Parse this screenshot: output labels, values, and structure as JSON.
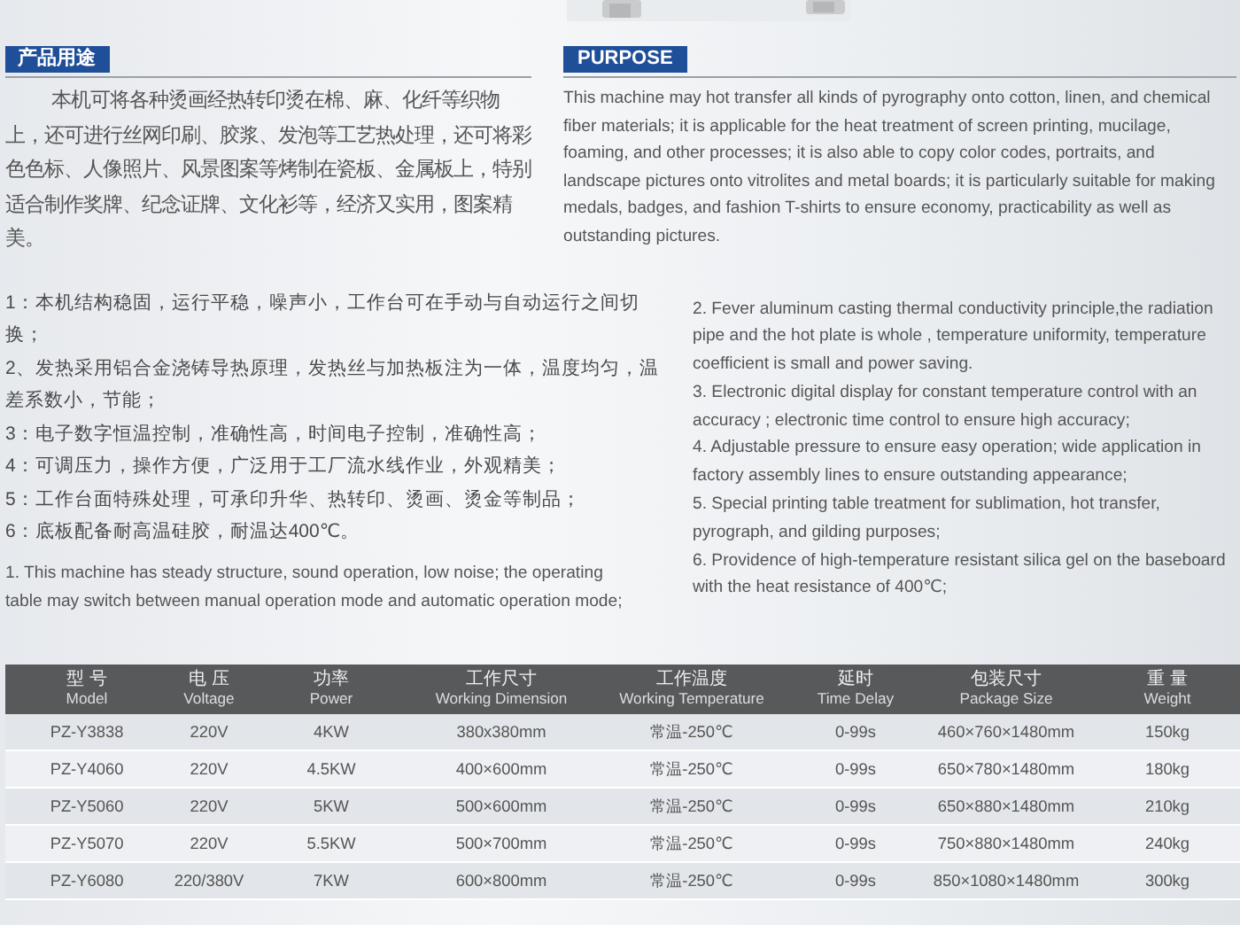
{
  "photo": {
    "kind": "picture"
  },
  "purpose_cn": {
    "heading": "产品用途",
    "text": "本机可将各种烫画经热转印烫在棉、麻、化纤等织物上，还可进行丝网印刷、胶浆、发泡等工艺热处理，还可将彩色色标、人像照片、风景图案等烤制在瓷板、金属板上，特别适合制作奖牌、纪念证牌、文化衫等，经济又实用，图案精美。"
  },
  "purpose_en": {
    "heading": "PURPOSE",
    "text": "This machine may hot transfer all kinds of pyrography onto cotton, linen, and chemical fiber materials; it is applicable for the heat treatment of screen printing, mucilage, foaming, and other processes; it is also able to copy color codes, portraits, and landscape pictures onto vitrolites and metal boards; it is particularly suitable for making medals, badges, and fashion T-shirts to ensure economy, practicability as well as outstanding pictures."
  },
  "features_cn": [
    "1：本机结构稳固，运行平稳，噪声小，工作台可在手动与自动运行之间切换；",
    "2、发热采用铝合金浇铸导热原理，发热丝与加热板注为一体，温度均匀，温差系数小，节能；",
    "3：电子数字恒温控制，准确性高，时间电子控制，准确性高；",
    "4：可调压力，操作方便，广泛用于工厂流水线作业，外观精美；",
    "5：工作台面特殊处理，可承印升华、热转印、烫画、烫金等制品；",
    "6：底板配备耐高温硅胶，耐温达400℃。"
  ],
  "features_en_left": [
    "1. This machine has steady structure, sound operation, low noise; the operating table may switch between manual operation mode and automatic operation mode;"
  ],
  "features_en_right": [
    "2. Fever  aluminum casting thermal conductivity principle,the radiation pipe and the hot plate is whole , temperature uniformity, temperature coefficient is small and power saving.",
    "3. Electronic digital display for constant temperature control with an accuracy ; electronic time control to ensure high accuracy;",
    "4. Adjustable pressure to ensure easy operation; wide application in factory assembly lines to ensure outstanding appearance;",
    "5. Special printing table treatment for sublimation, hot transfer, pyrograph, and gilding purposes;",
    "6. Providence of high-temperature resistant silica gel on the baseboard with the heat resistance of 400℃;"
  ],
  "table": {
    "columns": [
      {
        "cn": "型 号",
        "en": "Model"
      },
      {
        "cn": "电 压",
        "en": "Voltage"
      },
      {
        "cn": "功率",
        "en": "Power"
      },
      {
        "cn": "工作尺寸",
        "en": "Working Dimension"
      },
      {
        "cn": "工作温度",
        "en": "Working Temperature"
      },
      {
        "cn": "延时",
        "en": "Time Delay"
      },
      {
        "cn": "包装尺寸",
        "en": "Package Size"
      },
      {
        "cn": "重 量",
        "en": "Weight"
      }
    ],
    "rows": [
      [
        "PZ-Y3838",
        "220V",
        "4KW",
        "380x380mm",
        "常温-250℃",
        "0-99s",
        "460×760×1480mm",
        "150kg"
      ],
      [
        "PZ-Y4060",
        "220V",
        "4.5KW",
        "400×600mm",
        "常温-250℃",
        "0-99s",
        "650×780×1480mm",
        "180kg"
      ],
      [
        "PZ-Y5060",
        "220V",
        "5KW",
        "500×600mm",
        "常温-250℃",
        "0-99s",
        "650×880×1480mm",
        "210kg"
      ],
      [
        "PZ-Y5070",
        "220V",
        "5.5KW",
        "500×700mm",
        "常温-250℃",
        "0-99s",
        "750×880×1480mm",
        "240kg"
      ],
      [
        "PZ-Y6080",
        "220/380V",
        "7KW",
        "600×800mm",
        "常温-250℃",
        "0-99s",
        "850×1080×1480mm",
        "300kg"
      ]
    ]
  }
}
